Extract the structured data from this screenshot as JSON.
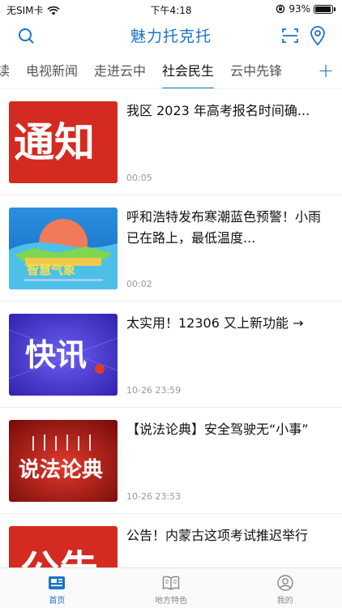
{
  "status_bar": {
    "carrier": "无SIM卡",
    "time": "下午4:18",
    "battery_percent": "93%",
    "battery_level": 0.93
  },
  "nav": {
    "title": "魅力托克托",
    "left_icon": "search-icon",
    "right_icons": [
      "scan-icon",
      "location-icon"
    ]
  },
  "tabs": {
    "items": [
      "读",
      "电视新闻",
      "走进云中",
      "社会民生",
      "云中先锋"
    ],
    "active_index": 3,
    "add_label": "+"
  },
  "news": [
    {
      "title": "我区 2023 年高考报名时间确...",
      "time": "00:05",
      "thumb_text": "通知"
    },
    {
      "title": "呼和浩特发布寒潮蓝色预警！小雨已在路上，最低温度...",
      "time": "00:02",
      "thumb_text": "智慧气象"
    },
    {
      "title": "太实用！12306 又上新功能 →",
      "time": "10-26 23:59",
      "thumb_text": "快讯"
    },
    {
      "title": "【说法论典】安全驾驶无“小事”",
      "time": "10-26 23:53",
      "thumb_text": "说法论典"
    },
    {
      "title": "公告！内蒙古这项考试推迟举行",
      "time": "",
      "thumb_text": "公告"
    }
  ],
  "bottom_tabs": [
    {
      "label": "首页",
      "icon": "home-news-icon",
      "active": true
    },
    {
      "label": "地方特色",
      "icon": "book-icon",
      "active": false
    },
    {
      "label": "我的",
      "icon": "profile-icon",
      "active": false
    }
  ],
  "colors": {
    "accent": "#1a73c9",
    "notice_red": "#d42a21",
    "flash_purple": "#4a35c8"
  }
}
